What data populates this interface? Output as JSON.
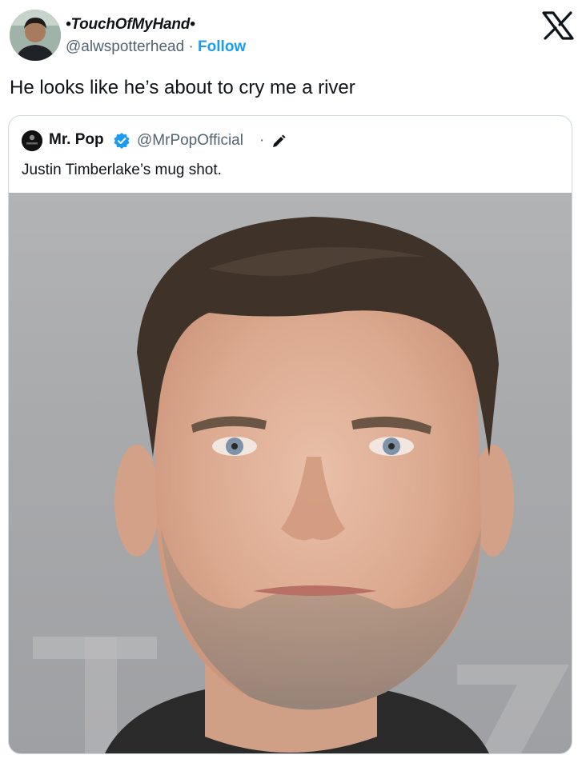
{
  "author": {
    "display_name": "•TouchOfMyHand•",
    "handle": "@alwspotterhead",
    "separator": "·",
    "follow_label": "Follow"
  },
  "tweet": {
    "text": "He looks like he’s about to cry me a river"
  },
  "quoted_tweet": {
    "display_name": "Mr. Pop",
    "handle": "@MrPopOfficial",
    "separator": "·",
    "text": "Justin Timberlake’s mug shot."
  },
  "icons": {
    "platform": "x-logo-icon",
    "verified": "verified-badge-icon",
    "edited": "pencil-icon"
  },
  "colors": {
    "accent": "#1d9bf0",
    "secondary_text": "#536471",
    "border": "#cfd9de"
  }
}
